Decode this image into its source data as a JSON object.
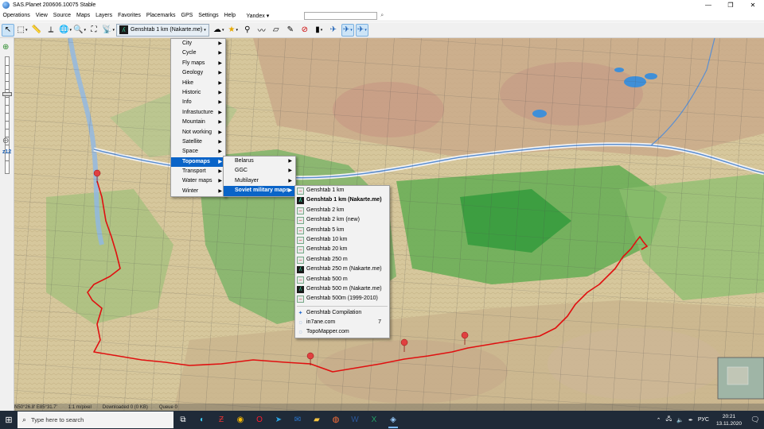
{
  "window": {
    "title": "SAS.Planet 200606.10075 Stable",
    "controls": [
      "—",
      "❐",
      "✕"
    ]
  },
  "menubar": {
    "items": [
      "Operations",
      "View",
      "Source",
      "Maps",
      "Layers",
      "Favorites",
      "Placemarks",
      "GPS",
      "Settings",
      "Help"
    ],
    "search_engine": "Yandex"
  },
  "toolbar": {
    "current_map": "Genshtab 1 km (Nakarte.me)"
  },
  "sidebar": {
    "zoom_label": "z12",
    "zoom_level": 12
  },
  "menus": {
    "level1": [
      {
        "label": "City",
        "has_sub": true
      },
      {
        "label": "Cycle",
        "has_sub": true
      },
      {
        "label": "Fly maps",
        "has_sub": true
      },
      {
        "label": "Geology",
        "has_sub": true
      },
      {
        "label": "Hike",
        "has_sub": true
      },
      {
        "label": "Historic",
        "has_sub": true
      },
      {
        "label": "Info",
        "has_sub": true
      },
      {
        "label": "Infrastucture",
        "has_sub": true
      },
      {
        "label": "Mountain",
        "has_sub": true
      },
      {
        "label": "Not working",
        "has_sub": true
      },
      {
        "label": "Satellite",
        "has_sub": true
      },
      {
        "label": "Space",
        "has_sub": true
      },
      {
        "label": "Topomaps",
        "has_sub": true,
        "selected": true
      },
      {
        "label": "Transport",
        "has_sub": true
      },
      {
        "label": "Water maps",
        "has_sub": true
      },
      {
        "label": "Winter",
        "has_sub": true
      }
    ],
    "level2": [
      {
        "label": "Belarus",
        "has_sub": true
      },
      {
        "label": "GGC",
        "has_sub": true
      },
      {
        "label": "Multilayer",
        "has_sub": true
      },
      {
        "label": "Soviet military maps",
        "has_sub": true,
        "selected": true
      }
    ],
    "level3": [
      {
        "label": "Genshtab 1 km",
        "icon": "genshtab-icon"
      },
      {
        "label": "Genshtab 1 km (Nakarte.me)",
        "icon": "nakarte-icon",
        "checked": true
      },
      {
        "label": "Genshtab 2 km",
        "icon": "genshtab-icon"
      },
      {
        "label": "Genshtab 2 km (new)",
        "icon": "genshtab-icon"
      },
      {
        "label": "Genshtab 5 km",
        "icon": "genshtab-icon"
      },
      {
        "label": "Genshtab 10 km",
        "icon": "genshtab-icon"
      },
      {
        "label": "Genshtab 20 km",
        "icon": "genshtab-icon"
      },
      {
        "label": "Genshtab 250 m",
        "icon": "genshtab-icon"
      },
      {
        "label": "Genshtab 250 m (Nakarte.me)",
        "icon": "nakarte-icon"
      },
      {
        "label": "Genshtab 500 m",
        "icon": "genshtab-icon"
      },
      {
        "label": "Genshtab 500 m (Nakarte.me)",
        "icon": "nakarte-icon"
      },
      {
        "label": "Genshtab 500m (1999-2010)",
        "icon": "genshtab-icon"
      },
      {
        "separator": true
      },
      {
        "label": "Genshtab Compilation",
        "icon": "compilation-icon"
      },
      {
        "label": "in7ane.com",
        "icon": "globe-icon",
        "hotkey": "7"
      },
      {
        "label": "TopoMapper.com",
        "icon": "globe-icon"
      }
    ]
  },
  "statusbar": {
    "items": [
      "N50°26.8′ E85°31.7′",
      "1:1 m/pixel",
      "Downloaded 0 (0 KB)",
      "Queue 0"
    ]
  },
  "taskbar": {
    "search_placeholder": "Type here to search",
    "time": "20:21",
    "date": "13.11.2020",
    "language": "РУС"
  },
  "colors": {
    "track": "#e01010",
    "menu_selected": "#0a64c8",
    "taskbar": "#1f2a38"
  }
}
